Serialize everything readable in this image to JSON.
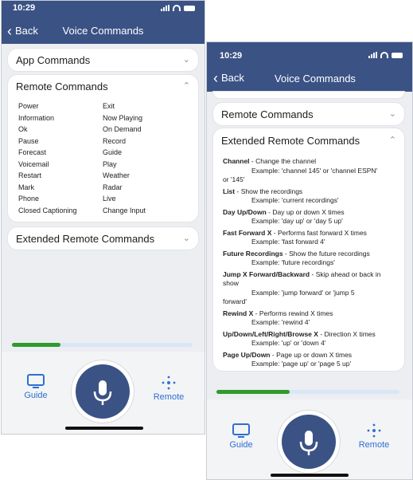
{
  "colors": {
    "header": "#3b5285",
    "accent": "#2f6fd0",
    "progress": "#2f9a2e"
  },
  "phoneA": {
    "status_time": "10:29",
    "back_label": "Back",
    "title": "Voice Commands",
    "app_commands_label": "App Commands",
    "remote_commands_label": "Remote Commands",
    "commands_left": [
      "Power",
      "Information",
      "Ok",
      "Pause",
      "Forecast",
      "Voicemail",
      "Restart",
      "Mark",
      "Phone",
      "Closed Captioning"
    ],
    "commands_right": [
      "Exit",
      "Now Playing",
      "On Demand",
      "Record",
      "Guide",
      "Play",
      "Weather",
      "Radar",
      "Live",
      "Change Input"
    ],
    "extended_label": "Extended Remote Commands",
    "progress_fraction": 0.27,
    "guide_label": "Guide",
    "remote_label": "Remote"
  },
  "phoneB": {
    "status_time": "10:29",
    "back_label": "Back",
    "title": "Voice Commands",
    "remote_commands_label": "Remote Commands",
    "extended_label": "Extended Remote Commands",
    "items": [
      {
        "name": "Channel",
        "desc": "- Change the channel",
        "example": "Example: 'channel 145' or 'channel ESPN'",
        "extra": "or '145'"
      },
      {
        "name": "List",
        "desc": "- Show the recordings",
        "example": "Example: 'current recordings'",
        "extra": ""
      },
      {
        "name": "Day Up/Down",
        "desc": "- Day up or down X times",
        "example": "Example: 'day up' or 'day 5 up'",
        "extra": ""
      },
      {
        "name": "Fast Forward X",
        "desc": "- Performs fast forward X times",
        "example": "Example: 'fast forward 4'",
        "extra": ""
      },
      {
        "name": "Future Recordings",
        "desc": "- Show the future recordings",
        "example": "Example: 'future recordings'",
        "extra": ""
      },
      {
        "name": "Jump X Forward/Backward",
        "desc": "- Skip ahead or back in show",
        "example": "Example: 'jump forward' or 'jump 5",
        "extra": "forward'"
      },
      {
        "name": "Rewind X",
        "desc": "- Performs rewind X times",
        "example": "Example: 'rewind 4'",
        "extra": ""
      },
      {
        "name": "Up/Down/Left/Right/Browse X",
        "desc": "- Direction X times",
        "example": "Example: 'up' or 'down 4'",
        "extra": ""
      },
      {
        "name": "Page Up/Down",
        "desc": "- Page up or down X times",
        "example": "Example: 'page up' or 'page 5 up'",
        "extra": ""
      }
    ],
    "progress_fraction": 0.4,
    "guide_label": "Guide",
    "remote_label": "Remote"
  }
}
